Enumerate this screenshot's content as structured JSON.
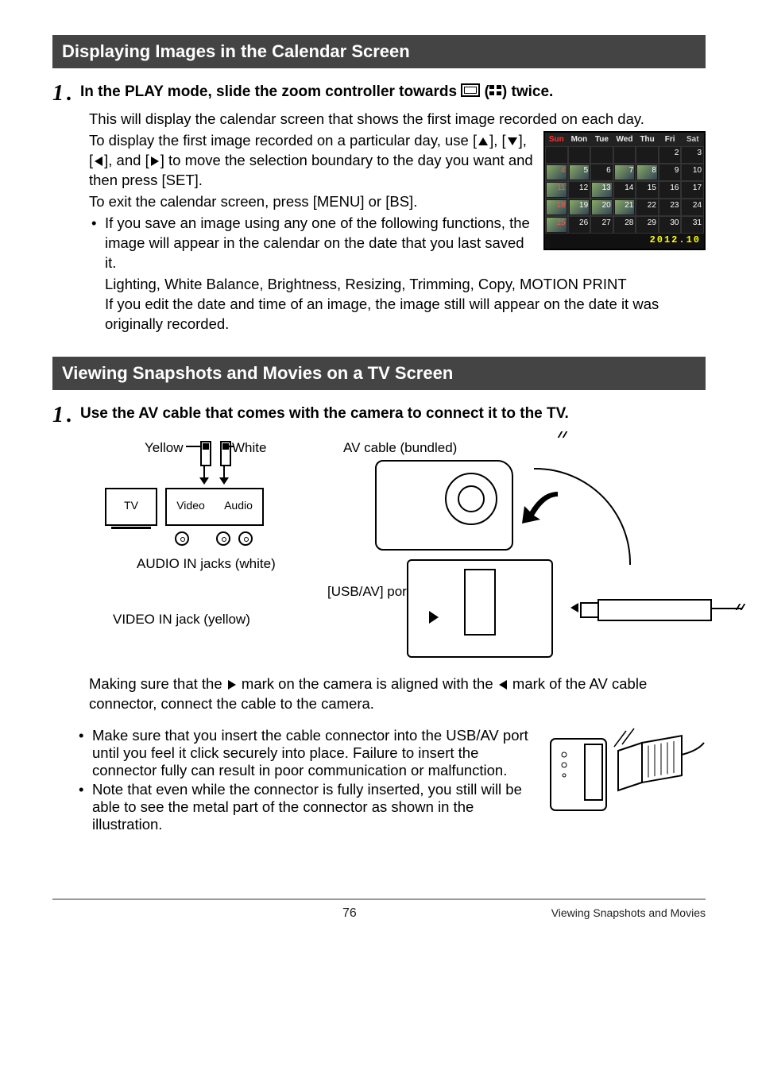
{
  "section1": {
    "title": "Displaying Images in the Calendar Screen",
    "step1": {
      "prefix": "In the PLAY mode, slide the zoom controller towards",
      "suffix": "twice.",
      "body1": "This will display the calendar screen that shows the first image recorded on each day.",
      "body2a": "To display the first image recorded on a particular day, use [",
      "body2b": "], [",
      "body2c": "], [",
      "body2d": "], and [",
      "body2e": "] to move the selection boundary to the day you want and then press [SET].",
      "body3": "To exit the calendar screen, press [MENU] or [BS].",
      "bullet1": "If you save an image using any one of the following functions, the image will appear in the calendar on the date that you last saved it.",
      "bullet1_sub": "Lighting, White Balance, Brightness, Resizing, Trimming, Copy, MOTION PRINT",
      "bullet1_note": "If you edit the date and time of an image, the image still will appear on the date it was originally recorded."
    }
  },
  "calendar": {
    "dow": [
      "Sun",
      "Mon",
      "Tue",
      "Wed",
      "Thu",
      "Fri",
      "Sat"
    ],
    "rows": [
      [
        "",
        "",
        "",
        "",
        "",
        "2",
        "3"
      ],
      [
        "4",
        "5",
        "6",
        "7",
        "8",
        "9",
        "10"
      ],
      [
        "11",
        "12",
        "13",
        "14",
        "15",
        "16",
        "17"
      ],
      [
        "18",
        "19",
        "20",
        "21",
        "22",
        "23",
        "24"
      ],
      [
        "25",
        "26",
        "27",
        "28",
        "29",
        "30",
        "31"
      ]
    ],
    "thumbs": [
      [],
      [
        0,
        1,
        3,
        4
      ],
      [
        0,
        2
      ],
      [
        0,
        1,
        2,
        3
      ],
      [
        0
      ]
    ],
    "date": "2012.10"
  },
  "section2": {
    "title": "Viewing Snapshots and Movies on a TV Screen",
    "step1_title": "Use the AV cable that comes with the camera to connect it to the TV.",
    "labels": {
      "yellow": "Yellow",
      "white": "White",
      "tv": "TV",
      "video": "Video",
      "audio": "Audio",
      "avcable": "AV cable (bundled)",
      "audioin": "AUDIO IN jacks (white)",
      "usbav": "[USB/AV] port",
      "videoin": "VIDEO IN jack (yellow)"
    },
    "note_a": "Making sure that the",
    "note_b": "mark on the camera is aligned with the",
    "note_c": "mark of the AV cable connector, connect the cable to the camera.",
    "bullet1": "Make sure that you insert the cable connector into the USB/AV port until you feel it click securely into place. Failure to insert the connector fully can result in poor communication or malfunction.",
    "bullet2": "Note that even while the connector is fully inserted, you still will be able to see the metal part of the connector as shown in the illustration."
  },
  "footer": {
    "page": "76",
    "title": "Viewing Snapshots and Movies"
  }
}
